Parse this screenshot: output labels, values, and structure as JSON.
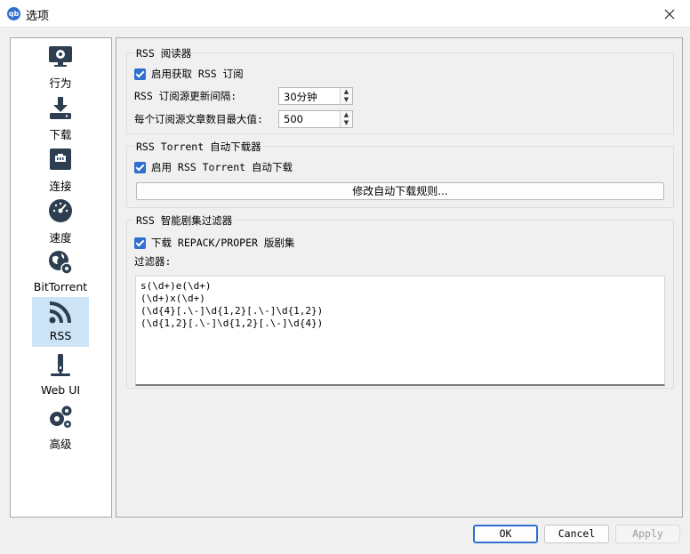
{
  "window": {
    "title": "选项",
    "app_icon_text": "qb"
  },
  "sidebar": {
    "items": [
      {
        "label": "行为",
        "icon": "monitor-gear-icon"
      },
      {
        "label": "下载",
        "icon": "download-icon"
      },
      {
        "label": "连接",
        "icon": "network-port-icon"
      },
      {
        "label": "速度",
        "icon": "speedometer-icon"
      },
      {
        "label": "BitTorrent",
        "icon": "globe-gear-icon"
      },
      {
        "label": "RSS",
        "icon": "rss-icon",
        "selected": true
      },
      {
        "label": "Web UI",
        "icon": "web-ui-icon"
      },
      {
        "label": "高级",
        "icon": "gears-icon"
      }
    ]
  },
  "rss_reader": {
    "title": "RSS 阅读器",
    "enable_label": "启用获取 RSS 订阅",
    "enabled": true,
    "interval_label": "RSS 订阅源更新间隔:",
    "interval_value": "30分钟",
    "max_articles_label": "每个订阅源文章数目最大值:",
    "max_articles_value": "500"
  },
  "auto_downloader": {
    "title": "RSS Torrent 自动下载器",
    "enable_label": "启用 RSS Torrent 自动下载",
    "enabled": true,
    "edit_rules_label": "修改自动下载规则..."
  },
  "smart_filter": {
    "title": "RSS 智能剧集过滤器",
    "repack_label": "下载 REPACK/PROPER 版剧集",
    "repack_enabled": true,
    "filters_label": "过滤器:",
    "filters_text": "s(\\d+)e(\\d+)\n(\\d+)x(\\d+)\n(\\d{4}[.\\-]\\d{1,2}[.\\-]\\d{1,2})\n(\\d{1,2}[.\\-]\\d{1,2}[.\\-]\\d{4})"
  },
  "buttons": {
    "ok": "OK",
    "cancel": "Cancel",
    "apply": "Apply"
  },
  "colors": {
    "accent": "#2f6fd0",
    "selected_bg": "#cde4f7"
  }
}
